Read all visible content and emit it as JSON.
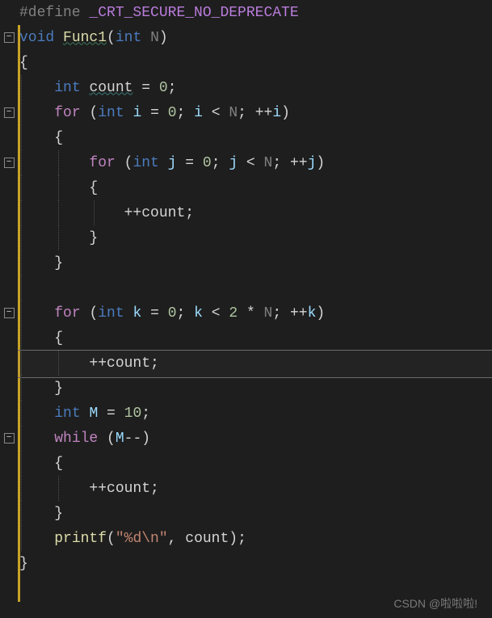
{
  "code": {
    "l1": {
      "pp": "#define ",
      "macro": "_CRT_SECURE_NO_DEPRECATE"
    },
    "l2": {
      "kw": "void ",
      "fn": "Func1",
      "p1": "(",
      "ty": "int ",
      "v": "N",
      "p2": ")"
    },
    "l3": {
      "b": "{"
    },
    "l4": {
      "space": "    ",
      "ty": "int ",
      "name": "count",
      "eq": " = ",
      "val": "0",
      "semi": ";"
    },
    "l5": {
      "space": "    ",
      "kw": "for ",
      "p1": "(",
      "ty": "int ",
      "v": "i",
      "eq": " = ",
      "val": "0",
      "semi1": "; ",
      "v2": "i",
      "lt": " < ",
      "N": "N",
      "semi2": "; ",
      "inc": "++",
      "v3": "i",
      "p2": ")"
    },
    "l6": {
      "space": "    ",
      "b": "{"
    },
    "l7": {
      "space": "        ",
      "kw": "for ",
      "p1": "(",
      "ty": "int ",
      "v": "j",
      "eq": " = ",
      "val": "0",
      "semi1": "; ",
      "v2": "j",
      "lt": " < ",
      "N": "N",
      "semi2": "; ",
      "inc": "++",
      "v3": "j",
      "p2": ")"
    },
    "l8": {
      "space": "        ",
      "b": "{"
    },
    "l9": {
      "space": "            ",
      "inc": "++",
      "v": "count",
      "semi": ";"
    },
    "l10": {
      "space": "        ",
      "b": "}"
    },
    "l11": {
      "space": "    ",
      "b": "}"
    },
    "l12": {
      "space": ""
    },
    "l13": {
      "space": "    ",
      "kw": "for ",
      "p1": "(",
      "ty": "int ",
      "v": "k",
      "eq": " = ",
      "val": "0",
      "semi1": "; ",
      "v2": "k",
      "lt": " < ",
      "two": "2",
      "mul": " * ",
      "N": "N",
      "semi2": "; ",
      "inc": "++",
      "v3": "k",
      "p2": ")"
    },
    "l14": {
      "space": "    ",
      "b": "{"
    },
    "l15": {
      "space": "        ",
      "inc": "++",
      "v": "count",
      "semi": ";"
    },
    "l16": {
      "space": "    ",
      "b": "}"
    },
    "l17": {
      "space": "    ",
      "ty": "int ",
      "v": "M",
      "eq": " = ",
      "val": "10",
      "semi": ";"
    },
    "l18": {
      "space": "    ",
      "kw": "while ",
      "p1": "(",
      "v": "M",
      "dec": "--",
      "p2": ")"
    },
    "l19": {
      "space": "    ",
      "b": "{"
    },
    "l20": {
      "space": "        ",
      "inc": "++",
      "v": "count",
      "semi": ";"
    },
    "l21": {
      "space": "    ",
      "b": "}"
    },
    "l22": {
      "space": "    ",
      "fn": "printf",
      "p1": "(",
      "str": "\"%d\\n\"",
      "comma": ", ",
      "v": "count",
      "p2": ")",
      "semi": ";"
    },
    "l23": {
      "b": "}"
    }
  },
  "watermark": "CSDN @啦啦啦!",
  "fold_marks": [
    2,
    5,
    7,
    13,
    18
  ]
}
